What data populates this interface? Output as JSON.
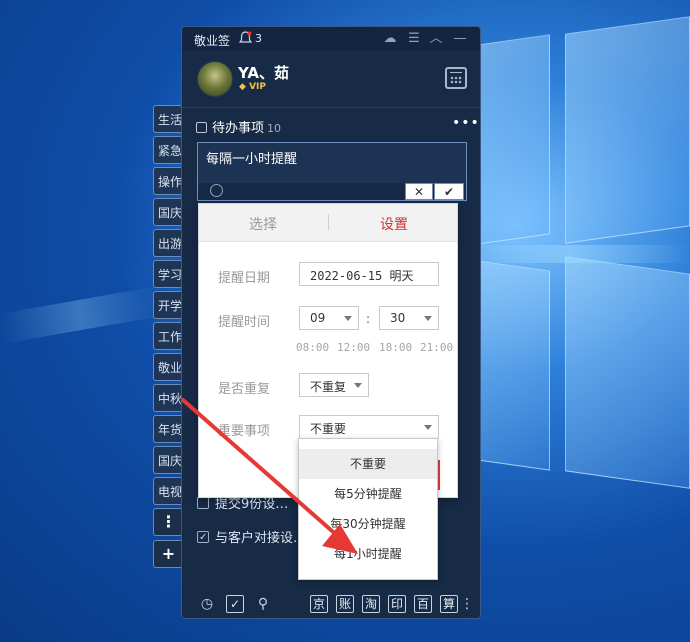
{
  "app": {
    "title": "敬业签",
    "notification_count": "3",
    "username": "YA、茹",
    "vip_badge": "VIP"
  },
  "side_tabs": [
    "生活",
    "紧急",
    "操作",
    "国庆",
    "出游",
    "学习",
    "开学",
    "工作",
    "敬业",
    "中秋",
    "年货",
    "国庆",
    "电视"
  ],
  "side_more": "⋮",
  "side_add": "+",
  "todo": {
    "section_title": "待办事项",
    "count": "10",
    "editor_text": "每隔一小时提醒",
    "cancel_symbol": "✕",
    "confirm_symbol": "✔",
    "visible_items": [
      {
        "text": "提交9份设…",
        "done": false
      },
      {
        "text": "与客户对接设…",
        "done": true
      }
    ]
  },
  "reminder_popup": {
    "tabs": [
      "选择",
      "设置"
    ],
    "active_tab": "设置",
    "date_label": "提醒日期",
    "date_value": "2022-06-15 明天",
    "time_label": "提醒时间",
    "hour_value": "09",
    "minute_value": "30",
    "time_colon": ":",
    "quick_times": [
      "08:00",
      "12:00",
      "18:00",
      "21:00"
    ],
    "repeat_label": "是否重复",
    "repeat_value": "不重复",
    "important_label": "重要事项",
    "important_value": "不重要",
    "important_options": [
      "不重要",
      "每5分钟提醒",
      "每30分钟提醒",
      "每1小时提醒"
    ],
    "selected_option": "不重要"
  },
  "bottom_bar": {
    "shortcuts": [
      "京",
      "账",
      "淘",
      "印",
      "百",
      "算"
    ]
  },
  "colors": {
    "panel_bg": "#172a46",
    "active_tab": "#d9302c",
    "annotation_arrow": "#e53935"
  }
}
